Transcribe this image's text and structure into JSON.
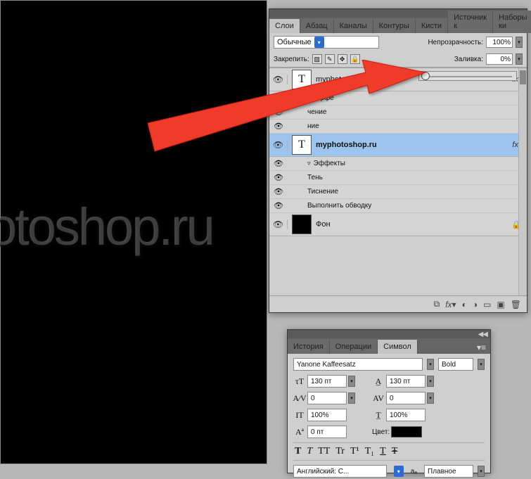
{
  "canvas": {
    "text": "hotoshop.ru"
  },
  "layersPanel": {
    "tabs": [
      "Слои",
      "Абзац",
      "Каналы",
      "Контуры",
      "Кисти",
      "Источник к",
      "Наборы ки"
    ],
    "activeTab": 0,
    "blendMode": "Обычные",
    "opacityLabel": "Непрозрачность:",
    "opacityValue": "100%",
    "lockLabel": "Закрепить:",
    "fillLabel": "Заливка:",
    "fillValue": "0%",
    "layers": [
      {
        "name": "myphotoshop.ru копия",
        "type": "text",
        "visible": true,
        "fx": true,
        "bold": false,
        "effects": [
          "Эффе",
          "чение",
          "ние"
        ]
      },
      {
        "name": "myphotoshop.ru",
        "type": "text",
        "visible": true,
        "fx": true,
        "bold": true,
        "selected": true,
        "effects": [
          "Эффекты",
          "Тень",
          "Тиснение",
          "Выполнить обводку"
        ]
      },
      {
        "name": "Фон",
        "type": "background",
        "visible": true,
        "locked": true
      }
    ],
    "footerIcons": [
      "link",
      "fx",
      "mask",
      "adjust",
      "group",
      "new",
      "trash"
    ]
  },
  "charPanel": {
    "tabs": [
      "История",
      "Операции",
      "Символ"
    ],
    "activeTab": 2,
    "font": "Yanone Kaffeesatz",
    "fontStyle": "Bold",
    "fontSize": "130 пт",
    "leading": "130 пт",
    "kerning": "0",
    "tracking": "0",
    "vscale": "100%",
    "hscale": "100%",
    "baseline": "0 пт",
    "colorLabel": "Цвет:",
    "typeButtons": [
      "T",
      "T",
      "TT",
      "Tr",
      "T¹",
      "T₁",
      "T",
      "Ŧ"
    ],
    "language": "Английский: С...",
    "aaLabel": "aₐ",
    "antialiasing": "Плавное"
  }
}
